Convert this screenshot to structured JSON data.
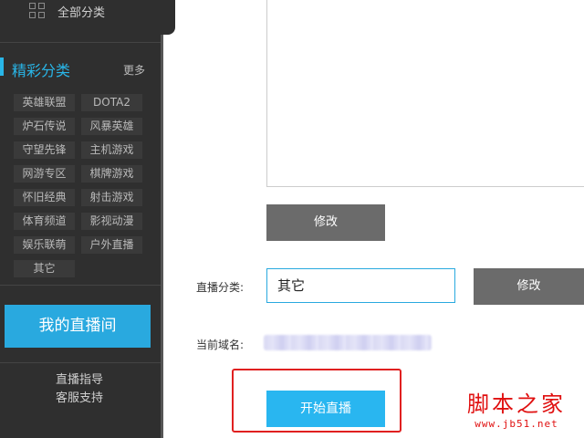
{
  "sidebar": {
    "all_categories": "全部分类",
    "section_title": "精彩分类",
    "more": "更多",
    "categories": [
      "英雄联盟",
      "DOTA2",
      "炉石传说",
      "风暴英雄",
      "守望先锋",
      "主机游戏",
      "网游专区",
      "棋牌游戏",
      "怀旧经典",
      "射击游戏",
      "体育频道",
      "影视动漫",
      "娱乐联萌",
      "户外直播",
      "其它"
    ],
    "my_room": "我的直播间",
    "links": [
      "直播指导",
      "客服支持"
    ]
  },
  "main": {
    "modify_button_1": "修改",
    "category_label": "直播分类:",
    "category_value": "其它",
    "modify_button_2": "修改",
    "domain_label": "当前域名:",
    "start_button": "开始直播"
  },
  "watermark": {
    "title": "脚本之家",
    "url": "www.jb51.net"
  },
  "colors": {
    "accent": "#29b6e8",
    "sidebar_bg": "#2f2f2f",
    "highlight": "#e02020"
  }
}
